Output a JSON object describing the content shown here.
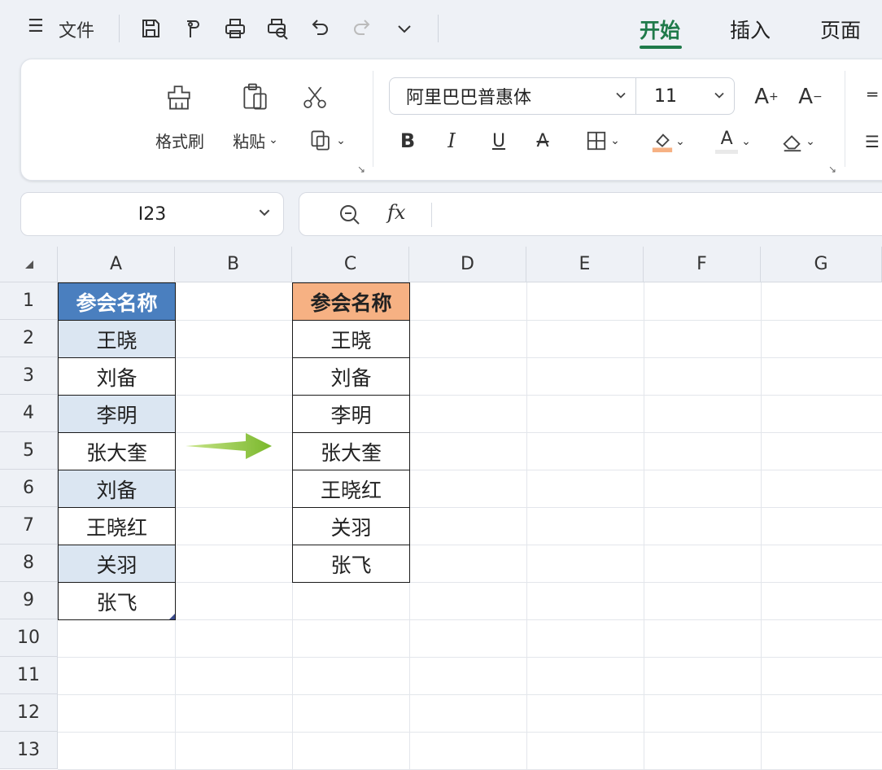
{
  "menu": {
    "icon": "menu-icon",
    "label": "文件"
  },
  "quick_access": [
    "save-icon",
    "format-paint-small-icon",
    "print-icon",
    "print-preview-icon",
    "undo-icon",
    "redo-icon",
    "more-chevron-icon"
  ],
  "tabs": [
    {
      "label": "开始",
      "active": true
    },
    {
      "label": "插入",
      "active": false
    },
    {
      "label": "页面",
      "active": false
    }
  ],
  "ribbon": {
    "format_painter": "格式刷",
    "paste": "粘贴",
    "font_name": "阿里巴巴普惠体",
    "font_size": "11",
    "bold": "B",
    "italic": "I",
    "underline": "U",
    "strike": "A",
    "increase_font": "A",
    "decrease_font": "A",
    "font_color_letter": "A"
  },
  "formula_bar": {
    "name_box": "I23",
    "fx": "fx",
    "value": ""
  },
  "columns": [
    "A",
    "B",
    "C",
    "D",
    "E",
    "F",
    "G"
  ],
  "rows": [
    "1",
    "2",
    "3",
    "4",
    "5",
    "6",
    "7",
    "8",
    "9",
    "10",
    "11",
    "12",
    "13"
  ],
  "column_a": [
    "参会名称",
    "王晓",
    "刘备",
    "李明",
    "张大奎",
    "刘备",
    "王晓红",
    "关羽",
    "张飞"
  ],
  "column_c": [
    "参会名称",
    "王晓",
    "刘备",
    "李明",
    "张大奎",
    "王晓红",
    "关羽",
    "张飞"
  ],
  "colors": {
    "accent": "#1f7a4a",
    "header_blue": "#4a7fbf",
    "header_orange": "#f6b183",
    "row_shade": "#dbe6f2",
    "arrow": "#8dc63f"
  }
}
